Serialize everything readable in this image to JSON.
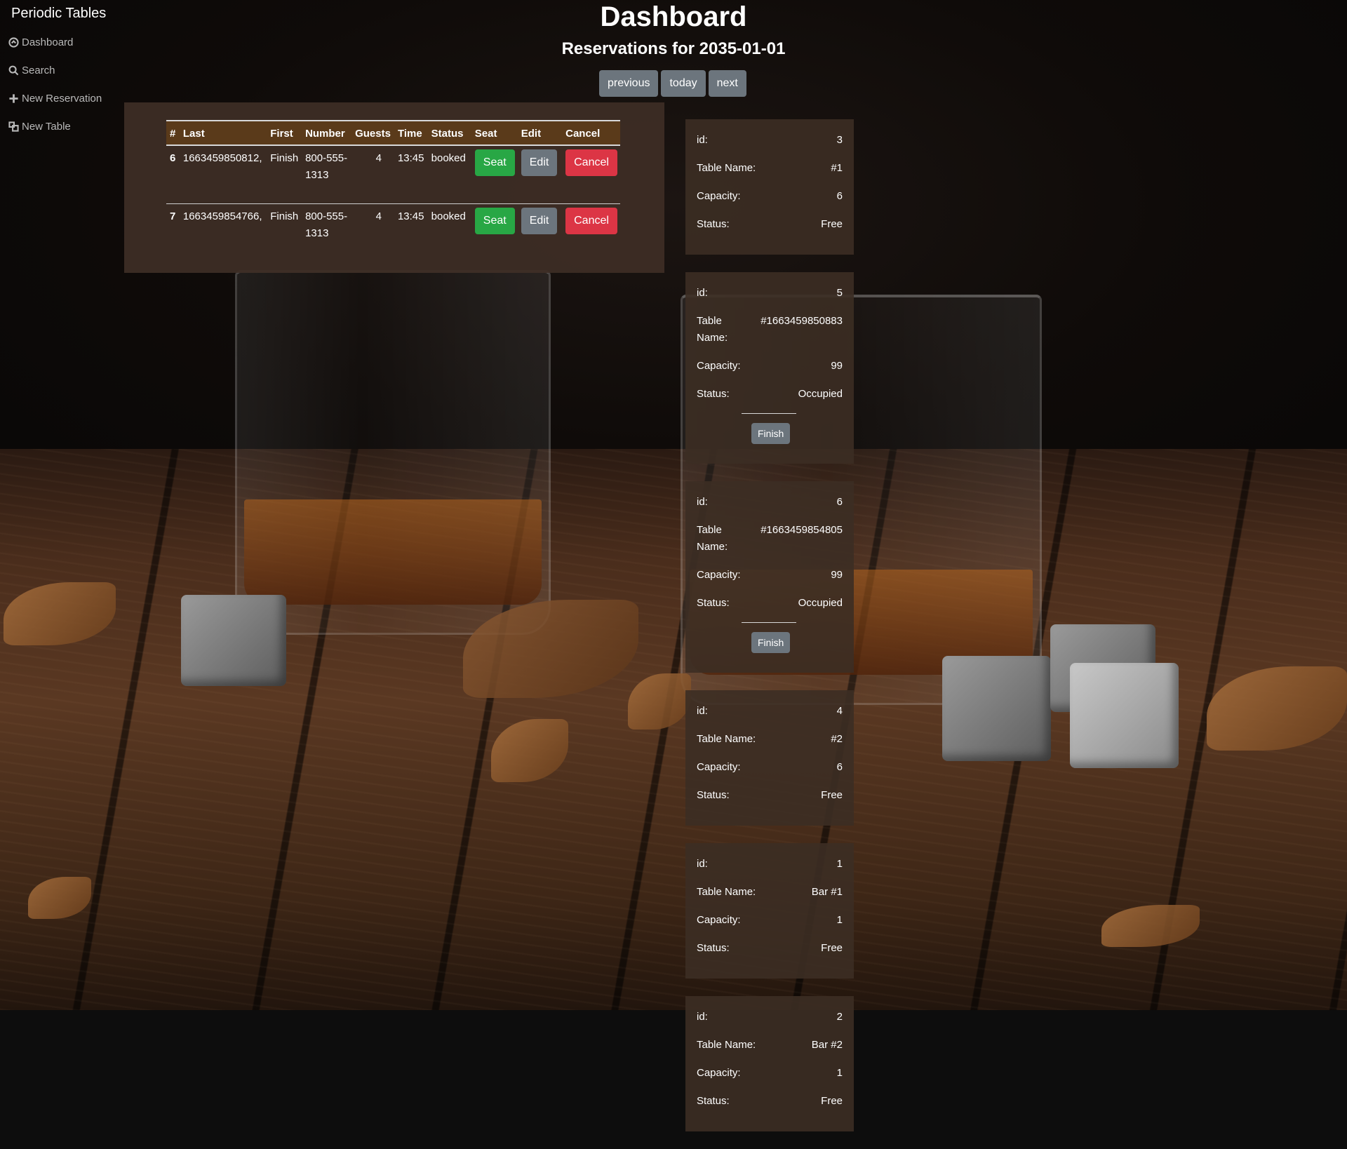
{
  "app": {
    "brand": "Periodic Tables"
  },
  "sidebar": {
    "items": [
      {
        "label": "Dashboard",
        "icon": "dashboard-icon"
      },
      {
        "label": "Search",
        "icon": "search-icon"
      },
      {
        "label": "New Reservation",
        "icon": "plus-icon"
      },
      {
        "label": "New Table",
        "icon": "new-table-icon"
      }
    ]
  },
  "header": {
    "title": "Dashboard",
    "subtitle": "Reservations for 2035-01-01",
    "previous_label": "previous",
    "today_label": "today",
    "next_label": "next"
  },
  "reservations": {
    "columns": [
      "#",
      "Last",
      "First",
      "Number",
      "Guests",
      "Time",
      "Status",
      "Seat",
      "Edit",
      "Cancel"
    ],
    "rows": [
      {
        "id": "6",
        "last": "1663459850812,",
        "first": "Finish",
        "number": "800-555-1313",
        "guests": "4",
        "time": "13:45",
        "status": "booked",
        "seat": "Seat",
        "edit": "Edit",
        "cancel": "Cancel"
      },
      {
        "id": "7",
        "last": "1663459854766,",
        "first": "Finish",
        "number": "800-555-1313",
        "guests": "4",
        "time": "13:45",
        "status": "booked",
        "seat": "Seat",
        "edit": "Edit",
        "cancel": "Cancel"
      }
    ]
  },
  "tables": {
    "labels": {
      "id": "id:",
      "name": "Table Name:",
      "capacity": "Capacity:",
      "status": "Status:",
      "finish": "Finish"
    },
    "items": [
      {
        "id": "3",
        "name": "#1",
        "capacity": "6",
        "status": "Free"
      },
      {
        "id": "5",
        "name": "#1663459850883",
        "capacity": "99",
        "status": "Occupied"
      },
      {
        "id": "6",
        "name": "#1663459854805",
        "capacity": "99",
        "status": "Occupied"
      },
      {
        "id": "4",
        "name": "#2",
        "capacity": "6",
        "status": "Free"
      },
      {
        "id": "1",
        "name": "Bar #1",
        "capacity": "1",
        "status": "Free"
      },
      {
        "id": "2",
        "name": "Bar #2",
        "capacity": "1",
        "status": "Free"
      }
    ]
  },
  "colors": {
    "panel": "#3c2d24",
    "table_header": "#5a3a1a",
    "button_gray": "#6c757d",
    "button_green": "#28a745",
    "button_red": "#dc3545"
  }
}
